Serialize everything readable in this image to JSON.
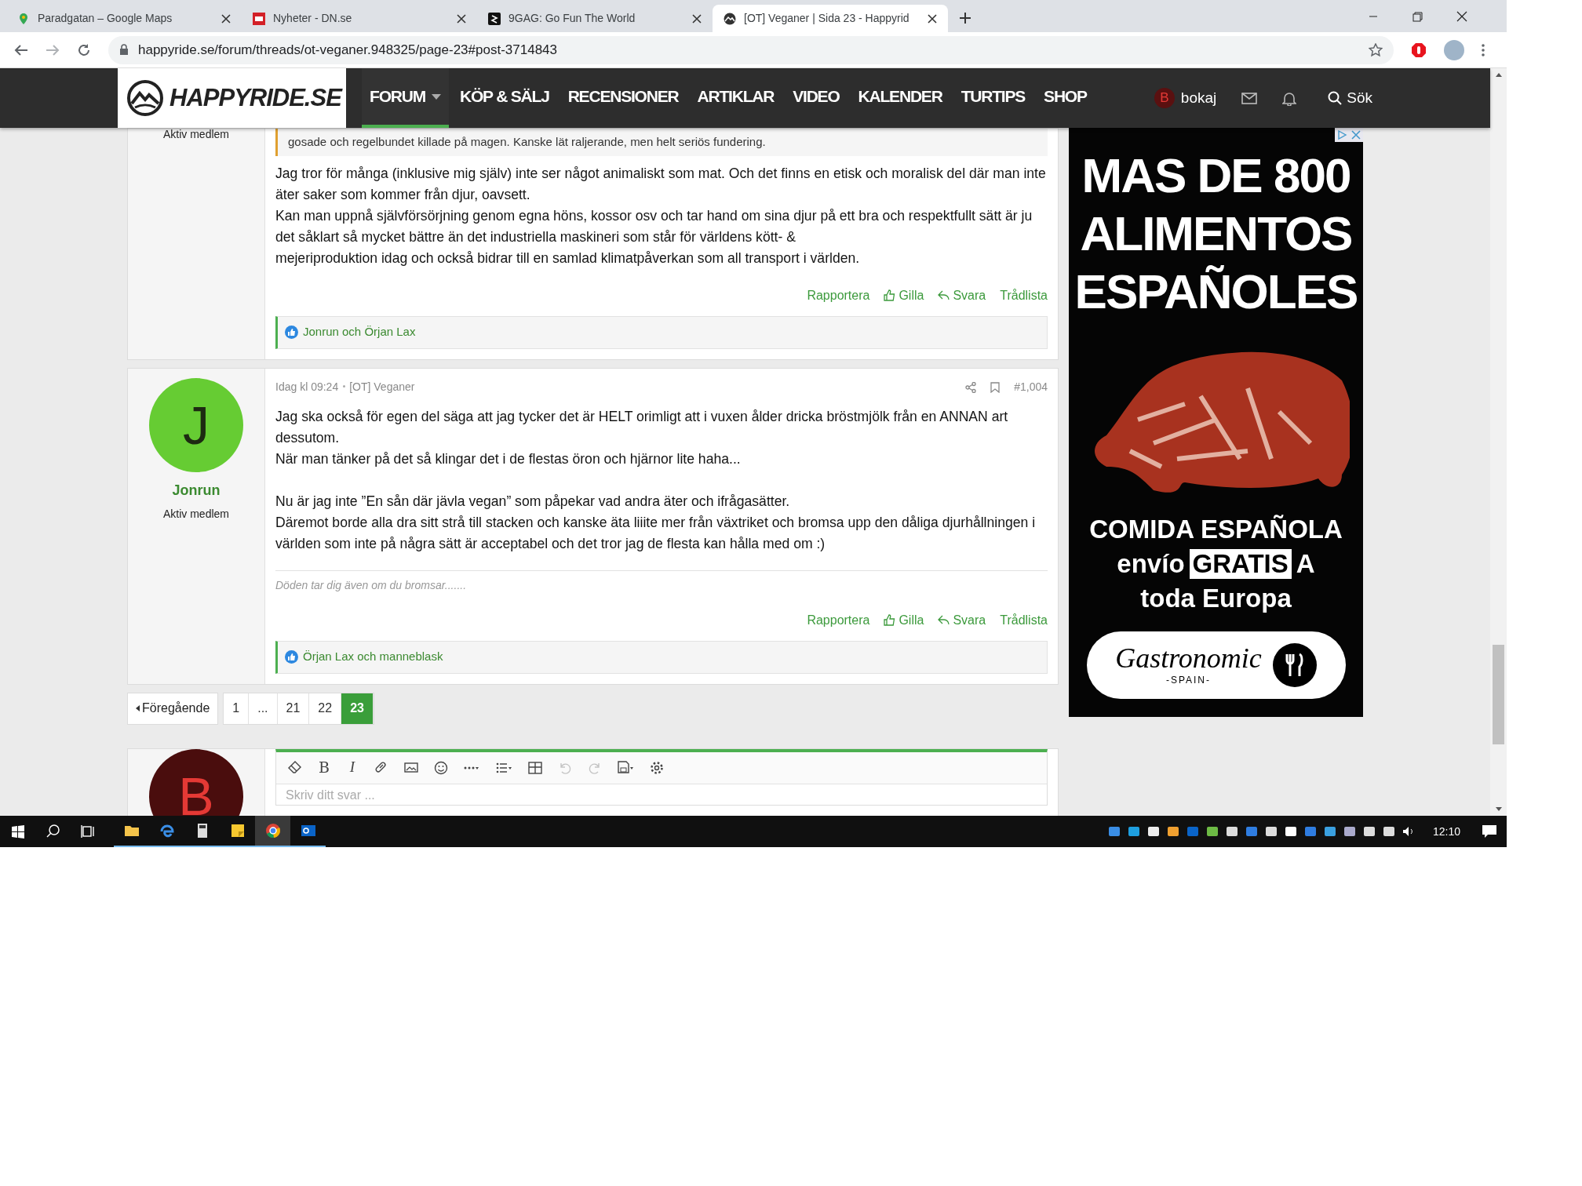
{
  "browser": {
    "tabs": [
      {
        "title": "Paradgatan – Google Maps",
        "selected": false
      },
      {
        "title": "Nyheter - DN.se",
        "selected": false
      },
      {
        "title": "9GAG: Go Fun The World",
        "selected": false
      },
      {
        "title": "[OT] Veganer | Sida 23 - Happyrid",
        "selected": true
      }
    ],
    "url": "happyride.se/forum/threads/ot-veganer.948325/page-23#post-3714843"
  },
  "site": {
    "logo": "HAPPYRIDE.SE",
    "nav": [
      {
        "label": "FORUM",
        "selected": true,
        "dropdown": true
      },
      {
        "label": "KÖP & SÄLJ",
        "selected": false,
        "dropdown": false
      },
      {
        "label": "RECENSIONER",
        "selected": false,
        "dropdown": false
      },
      {
        "label": "ARTIKLAR",
        "selected": false,
        "dropdown": false
      },
      {
        "label": "VIDEO",
        "selected": false,
        "dropdown": false
      },
      {
        "label": "KALENDER",
        "selected": false,
        "dropdown": false
      },
      {
        "label": "TURTIPS",
        "selected": false,
        "dropdown": false
      },
      {
        "label": "SHOP",
        "selected": false,
        "dropdown": false
      }
    ],
    "user": {
      "initial": "B",
      "name": "bokaj"
    },
    "search_label": "Sök"
  },
  "posts": [
    {
      "author": {
        "role": "Aktiv medlem"
      },
      "quote": "gosade och regelbundet killade på magen. Kanske lät raljerande, men helt seriös fundering.",
      "paragraphs": [
        [
          "Jag tror för många (inklusive mig själv) inte ser något animaliskt som mat. Och det finns en etisk och moralisk del där man inte äter saker som kommer från djur, oavsett.",
          "Kan man uppnå självförsörjning genom egna höns, kossor osv och tar hand om sina djur på ett bra och respektfullt sätt är ju det såklart så mycket bättre än det industriella maskineri som står för världens kött- &",
          "mejeriproduktion idag och också bidrar till en samlad klimatpåverkan som all transport i världen."
        ]
      ],
      "actions": [
        "Rapportera",
        "Gilla",
        "Svara",
        "Trådlista"
      ],
      "likes": "Jonrun och Örjan Lax"
    },
    {
      "author": {
        "initial": "J",
        "name": "Jonrun",
        "role": "Aktiv medlem",
        "color": "#66cc33"
      },
      "date": "Idag kl 09:24",
      "thread": "[OT] Veganer",
      "number": "#1,004",
      "paragraphs": [
        [
          "Jag ska också för egen del säga att jag tycker det är HELT orimligt att i vuxen ålder dricka bröstmjölk från en ANNAN art dessutom.",
          "När man tänker på det så klingar det i de flestas öron och hjärnor lite haha..."
        ],
        [
          "Nu är jag inte ”En sån där jävla vegan” som påpekar vad andra äter och ifrågasätter.",
          "Däremot borde alla dra sitt strå till stacken och kanske äta liiite mer från växtriket och bromsa upp den dåliga djurhållningen i världen som inte på några sätt är acceptabel och det tror jag de flesta kan hålla med om :)"
        ]
      ],
      "signature": "Döden tar dig även om du bromsar.......",
      "actions": [
        "Rapportera",
        "Gilla",
        "Svara",
        "Trådlista"
      ],
      "likes": "Örjan Lax och manneblask"
    }
  ],
  "pagination": {
    "prev": "Föregående",
    "pages": [
      {
        "label": "1",
        "selected": false
      },
      {
        "label": "...",
        "selected": false
      },
      {
        "label": "21",
        "selected": false
      },
      {
        "label": "22",
        "selected": false
      },
      {
        "label": "23",
        "selected": true
      }
    ]
  },
  "editor": {
    "avatar_initial": "B",
    "placeholder": "Skriv ditt svar ...",
    "toolbar": [
      {
        "kind": "eraser",
        "disabled": false
      },
      {
        "kind": "bold",
        "label": "B",
        "disabled": false
      },
      {
        "kind": "italic",
        "label": "I",
        "disabled": false
      },
      {
        "kind": "link",
        "disabled": false
      },
      {
        "kind": "image",
        "disabled": false
      },
      {
        "kind": "emoji",
        "disabled": false
      },
      {
        "kind": "more",
        "disabled": false
      },
      {
        "kind": "list",
        "disabled": false
      },
      {
        "kind": "table",
        "disabled": false
      },
      {
        "kind": "undo",
        "disabled": true
      },
      {
        "kind": "redo",
        "disabled": true
      },
      {
        "kind": "save",
        "disabled": false
      },
      {
        "kind": "settings",
        "disabled": false
      }
    ]
  },
  "ad": {
    "headline": [
      "MAS DE 800",
      "ALIMENTOS",
      "ESPAÑOLES"
    ],
    "line1": "COMIDA ESPAÑOLA",
    "line2_before": "envío",
    "line2_highlight": "GRATIS",
    "line2_after": "A",
    "line3": "toda Europa",
    "brand": "Gastronomic",
    "brand_sub": "-SPAIN-"
  },
  "taskbar": {
    "time": "12:10"
  }
}
